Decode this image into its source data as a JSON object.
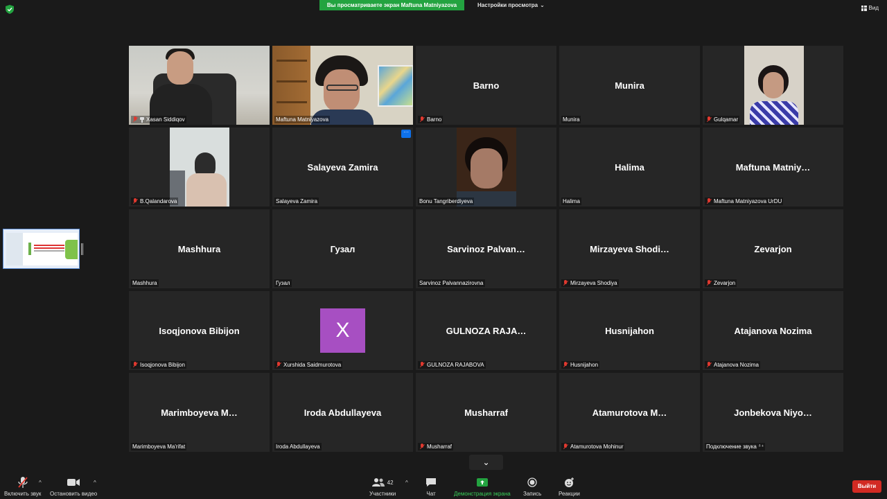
{
  "topbar": {
    "sharing_banner": "Вы просматриваете экран Maftuna Matniyazova",
    "view_settings": "Настройки просмотра",
    "view_button": "Вид"
  },
  "participants": [
    {
      "display": "",
      "label": "Xasan Siddiqov",
      "muted": true,
      "pinned": true,
      "video": "v-room"
    },
    {
      "display": "",
      "label": "Maftuna Matniyazova",
      "muted": false,
      "active": true,
      "video": "v-office"
    },
    {
      "display": "Barno",
      "label": "Barno",
      "muted": true
    },
    {
      "display": "Munira",
      "label": "Munira",
      "muted": false
    },
    {
      "display": "",
      "label": "Gulqamar",
      "muted": true,
      "video": "v-girl"
    },
    {
      "display": "",
      "label": "B.Qalandarova",
      "muted": true,
      "video": "v-phone"
    },
    {
      "display": "Salayeva Zamira",
      "label": "Salayeva Zamira",
      "muted": false,
      "more": "···"
    },
    {
      "display": "",
      "label": "Bonu Tangriberdiyeva",
      "muted": false,
      "video": "v-dark"
    },
    {
      "display": "Halima",
      "label": "Halima",
      "muted": false
    },
    {
      "display": "Maftuna  Matniy…",
      "label": "Maftuna Matniyazova UrDU",
      "muted": true
    },
    {
      "display": "Mashhura",
      "label": "Mashhura",
      "muted": false
    },
    {
      "display": "Гузал",
      "label": "Гузал",
      "muted": false
    },
    {
      "display": "Sarvinoz  Palvan…",
      "label": "Sarvinoz Palvannazirovna",
      "muted": false
    },
    {
      "display": "Mirzayeva  Shodi…",
      "label": "Mirzayeva Shodiya",
      "muted": true
    },
    {
      "display": "Zevarjon",
      "label": "Zevarjon",
      "muted": true
    },
    {
      "display": "Isoqjonova Bibijon",
      "label": "Isoqjonova Bibijon",
      "muted": true
    },
    {
      "display": "",
      "label": "Xurshida Saidmurotova",
      "muted": true,
      "avatar": "X"
    },
    {
      "display": "GULNOZA  RAJA…",
      "label": "GULNOZA RAJABOVA",
      "muted": true
    },
    {
      "display": "Husnijahon",
      "label": "Husnijahon",
      "muted": true
    },
    {
      "display": "Atajanova Nozima",
      "label": "Atajanova Nozima",
      "muted": true
    },
    {
      "display": "Marimboyeva  M…",
      "label": "Marimboyeva Ma'rifat",
      "muted": false
    },
    {
      "display": "Iroda Abdullayeva",
      "label": "Iroda Abdullayeva",
      "muted": false
    },
    {
      "display": "Musharraf",
      "label": "Musharraf",
      "muted": true
    },
    {
      "display": "Atamurotova  M…",
      "label": "Atamurotova Mohinur",
      "muted": true
    },
    {
      "display": "Jonbekova  Niyo…",
      "label": "Подключение звука ⁺̇⁺",
      "muted": false
    }
  ],
  "toolbar": {
    "unmute": "Включить звук",
    "stop_video": "Остановить видео",
    "participants": "Участники",
    "participants_count": "42",
    "chat": "Чат",
    "share_screen": "Демонстрация экрана",
    "record": "Запись",
    "reactions": "Реакции",
    "leave": "Выйти"
  },
  "colors": {
    "background": "#1a1a1a",
    "tile": "#262626",
    "share_green": "#23a340",
    "leave_red": "#d22a23",
    "active_speaker": "#e8e85b",
    "muted_red": "#e0392f"
  }
}
